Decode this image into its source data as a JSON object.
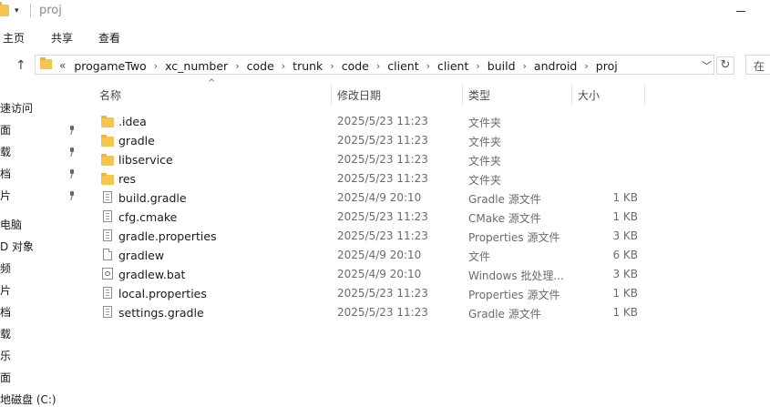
{
  "title": {
    "text": "proj",
    "qa_arrow": "▾"
  },
  "ribbon": {
    "tabs": [
      "主页",
      "共享",
      "查看"
    ]
  },
  "nav": {
    "up_glyph": "↑",
    "refresh_glyph": "↻",
    "dropdown_glyph": "﹀"
  },
  "address": {
    "lead": "«",
    "crumbs": [
      "progameTwo",
      "xc_number",
      "code",
      "trunk",
      "code",
      "client",
      "client",
      "build",
      "android",
      "proj"
    ],
    "separator": "›"
  },
  "search": {
    "partial_text": "在"
  },
  "sidebar": {
    "items": [
      {
        "label": "速访问",
        "pinned": false
      },
      {
        "label": "面",
        "pinned": true
      },
      {
        "label": "载",
        "pinned": true
      },
      {
        "label": "档",
        "pinned": true
      },
      {
        "label": "片",
        "pinned": true
      },
      {
        "label": "电脑",
        "pinned": false
      },
      {
        "label": "D 对象",
        "pinned": false
      },
      {
        "label": "频",
        "pinned": false
      },
      {
        "label": "片",
        "pinned": false
      },
      {
        "label": "档",
        "pinned": false
      },
      {
        "label": "载",
        "pinned": false
      },
      {
        "label": "乐",
        "pinned": false
      },
      {
        "label": "面",
        "pinned": false
      },
      {
        "label": "地磁盘 (C:)",
        "pinned": false
      }
    ]
  },
  "columns": {
    "name": "名称",
    "date": "修改日期",
    "type": "类型",
    "size": "大小",
    "sort_glyph": "^"
  },
  "files": [
    {
      "name": ".idea",
      "date": "2025/5/23 11:23",
      "type": "文件夹",
      "size": "",
      "icon": "folder-icon"
    },
    {
      "name": "gradle",
      "date": "2025/5/23 11:23",
      "type": "文件夹",
      "size": "",
      "icon": "folder-icon"
    },
    {
      "name": "libservice",
      "date": "2025/5/23 11:23",
      "type": "文件夹",
      "size": "",
      "icon": "folder-icon"
    },
    {
      "name": "res",
      "date": "2025/5/23 11:23",
      "type": "文件夹",
      "size": "",
      "icon": "folder-icon"
    },
    {
      "name": "build.gradle",
      "date": "2025/4/9 20:10",
      "type": "Gradle 源文件",
      "size": "1 KB",
      "icon": "text-file-icon"
    },
    {
      "name": "cfg.cmake",
      "date": "2025/5/23 11:23",
      "type": "CMake 源文件",
      "size": "1 KB",
      "icon": "text-file-icon"
    },
    {
      "name": "gradle.properties",
      "date": "2025/5/23 11:23",
      "type": "Properties 源文件",
      "size": "3 KB",
      "icon": "text-file-icon"
    },
    {
      "name": "gradlew",
      "date": "2025/4/9 20:10",
      "type": "文件",
      "size": "6 KB",
      "icon": "blank-file-icon"
    },
    {
      "name": "gradlew.bat",
      "date": "2025/4/9 20:10",
      "type": "Windows 批处理...",
      "size": "3 KB",
      "icon": "batch-file-icon"
    },
    {
      "name": "local.properties",
      "date": "2025/5/23 11:23",
      "type": "Properties 源文件",
      "size": "1 KB",
      "icon": "text-file-icon"
    },
    {
      "name": "settings.gradle",
      "date": "2025/5/23 11:23",
      "type": "Gradle 源文件",
      "size": "1 KB",
      "icon": "text-file-icon"
    }
  ],
  "colors": {
    "folder": "#f6c54d",
    "folder_tab": "#e9b43b",
    "muted_text": "#6b6b6b",
    "border": "#d9d9d9"
  }
}
